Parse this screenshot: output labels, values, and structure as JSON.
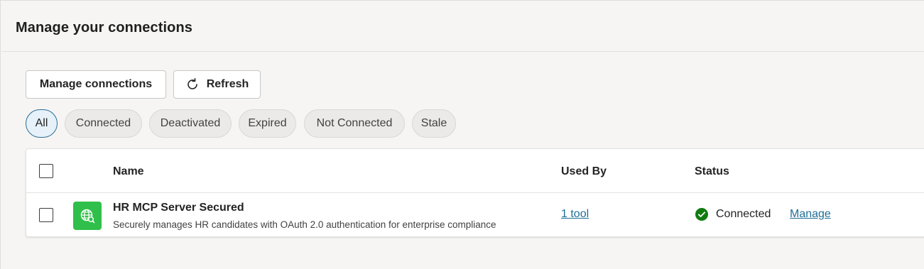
{
  "header": {
    "title": "Manage your connections"
  },
  "toolbar": {
    "manage_label": "Manage connections",
    "refresh_label": "Refresh",
    "refresh_icon": "refresh-icon"
  },
  "filters": [
    {
      "label": "All",
      "selected": true
    },
    {
      "label": "Connected",
      "selected": false
    },
    {
      "label": "Deactivated",
      "selected": false
    },
    {
      "label": "Expired",
      "selected": false
    },
    {
      "label": "Not Connected",
      "selected": false
    },
    {
      "label": "Stale",
      "selected": false
    }
  ],
  "table": {
    "columns": {
      "name": "Name",
      "used_by": "Used By",
      "status": "Status"
    },
    "rows": [
      {
        "name": "HR MCP Server Secured",
        "description": "Securely manages HR candidates with OAuth 2.0 authentication for enterprise compliance",
        "used_by": "1 tool",
        "status": "Connected",
        "action": "Manage",
        "icon": "globe-icon",
        "status_icon": "check-circle-icon"
      }
    ]
  },
  "colors": {
    "accent": "#1f6f97",
    "icon_bg": "#2fbf4a",
    "status_ok": "#107c10",
    "selected_pill_bg": "#e6f1f9",
    "selected_pill_border": "#2b6c93"
  }
}
